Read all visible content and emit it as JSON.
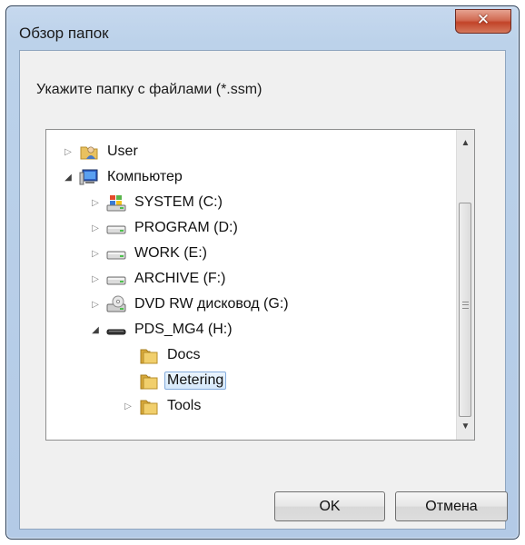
{
  "dialog": {
    "title": "Обзор папок",
    "prompt": "Укажите папку с файлами (*.ssm)",
    "ok_label": "OK",
    "cancel_label": "Отмена"
  },
  "tree": {
    "items": [
      {
        "label": "User",
        "icon": "user-folder-icon",
        "expander": "collapsed"
      },
      {
        "label": "Компьютер",
        "icon": "computer-icon",
        "expander": "expanded"
      },
      {
        "label": "SYSTEM (C:)",
        "icon": "windows-drive-icon",
        "expander": "collapsed"
      },
      {
        "label": "PROGRAM (D:)",
        "icon": "hard-drive-icon",
        "expander": "collapsed"
      },
      {
        "label": "WORK (E:)",
        "icon": "hard-drive-icon",
        "expander": "collapsed"
      },
      {
        "label": "ARCHIVE (F:)",
        "icon": "hard-drive-icon",
        "expander": "collapsed"
      },
      {
        "label": "DVD RW дисковод (G:)",
        "icon": "dvd-drive-icon",
        "expander": "collapsed"
      },
      {
        "label": "PDS_MG4 (H:)",
        "icon": "removable-drive-icon",
        "expander": "expanded"
      },
      {
        "label": "Docs",
        "icon": "folder-icon",
        "expander": "none"
      },
      {
        "label": "Metering",
        "icon": "folder-icon",
        "expander": "none",
        "selected": true
      },
      {
        "label": "Tools",
        "icon": "folder-icon",
        "expander": "collapsed"
      }
    ]
  },
  "colors": {
    "selection_border": "#84acdd",
    "close_button": "#c24329",
    "frame": "#bcd2ea"
  }
}
